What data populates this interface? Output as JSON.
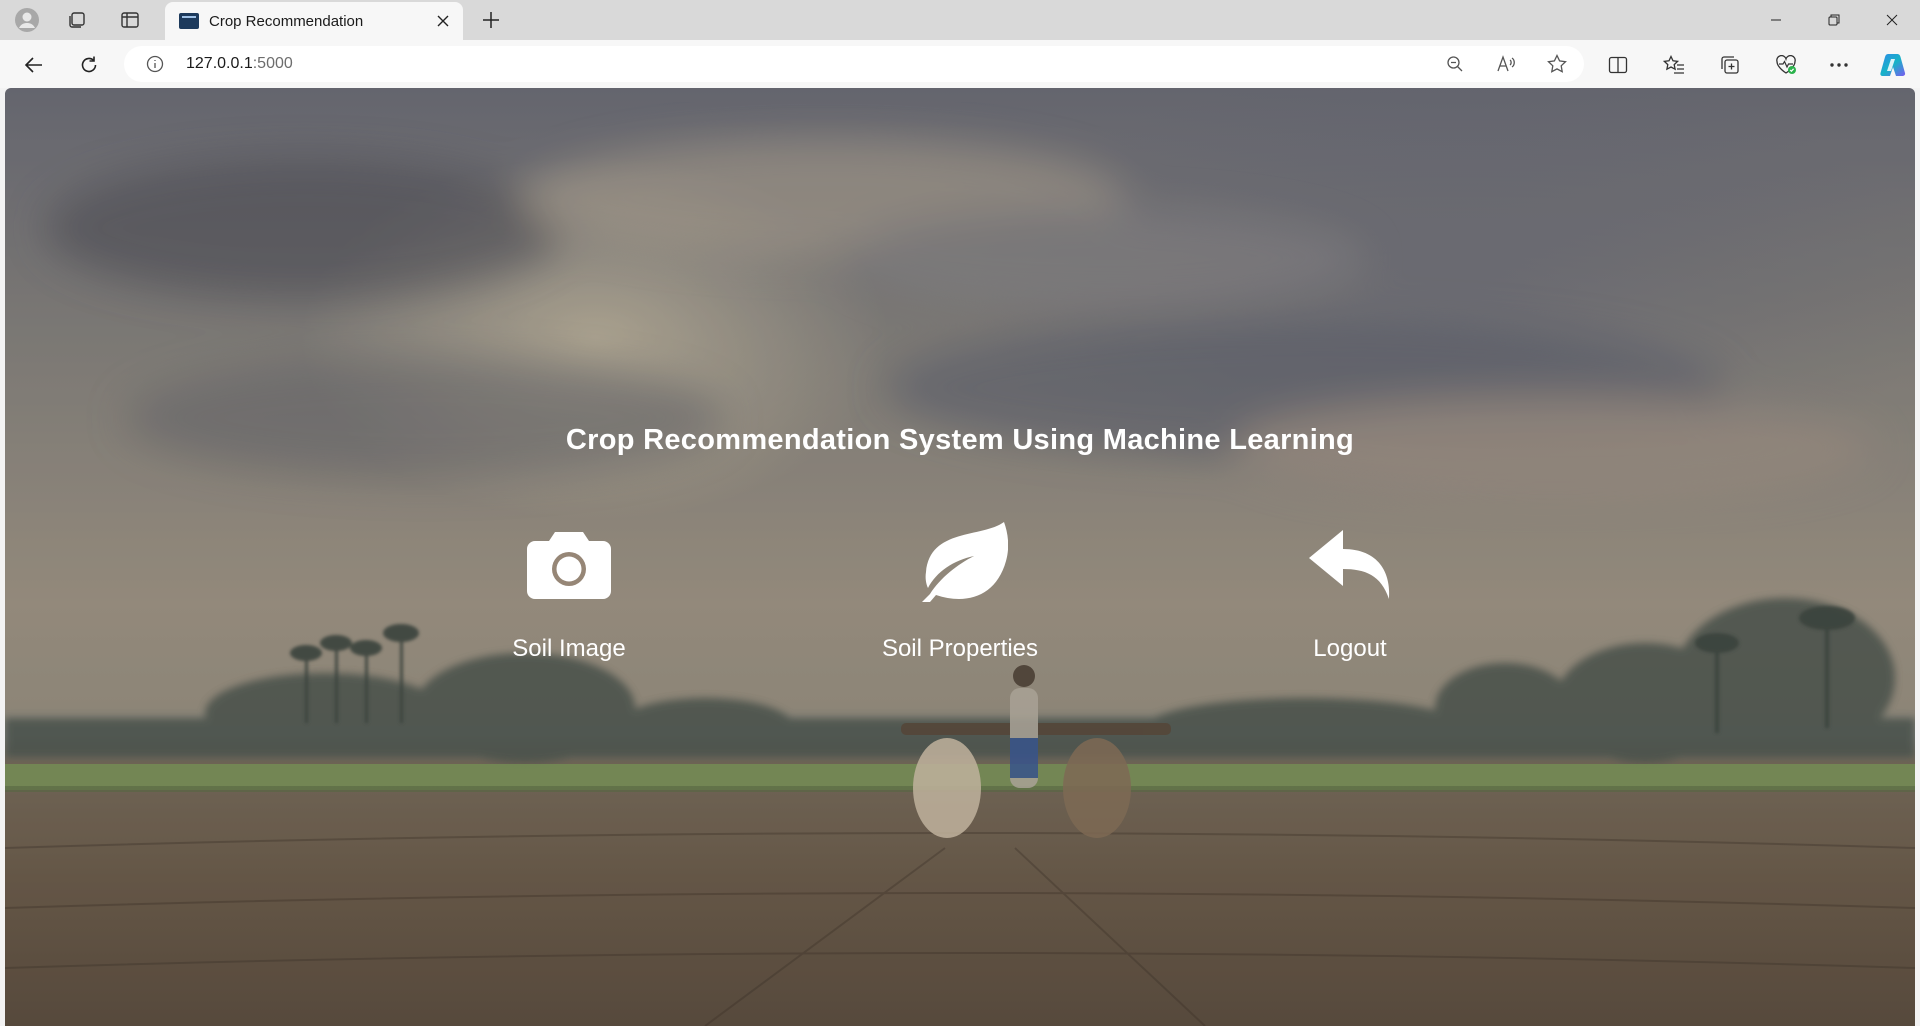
{
  "browser": {
    "tab": {
      "title": "Crop Recommendation"
    },
    "address": {
      "host": "127.0.0.1",
      "port": ":5000"
    },
    "icons": {
      "profile": "profile-icon",
      "workspaces": "workspaces-icon",
      "tab_actions": "tab-actions-icon",
      "close_tab": "close-icon",
      "new_tab": "plus-icon",
      "back": "back-arrow-icon",
      "refresh": "refresh-icon",
      "site_info": "info-icon",
      "zoom": "zoom-out-icon",
      "read_aloud": "read-aloud-icon",
      "favorite": "star-icon",
      "split_screen": "split-screen-icon",
      "favorites": "favorites-icon",
      "collections": "collections-icon",
      "browser_essentials": "heart-pulse-icon",
      "more": "more-icon",
      "copilot": "copilot-icon"
    }
  },
  "page": {
    "title": "Crop Recommendation System Using Machine Learning",
    "actions": [
      {
        "label": "Soil Image",
        "icon": "camera-icon"
      },
      {
        "label": "Soil Properties",
        "icon": "leaf-icon"
      },
      {
        "label": "Logout",
        "icon": "reply-arrow-icon"
      }
    ]
  },
  "colors": {
    "text": "#ffffff",
    "tab_strip": "#d9d9d9",
    "toolbar": "#f7f7f7",
    "copilot_accent": "#2f8be8"
  }
}
